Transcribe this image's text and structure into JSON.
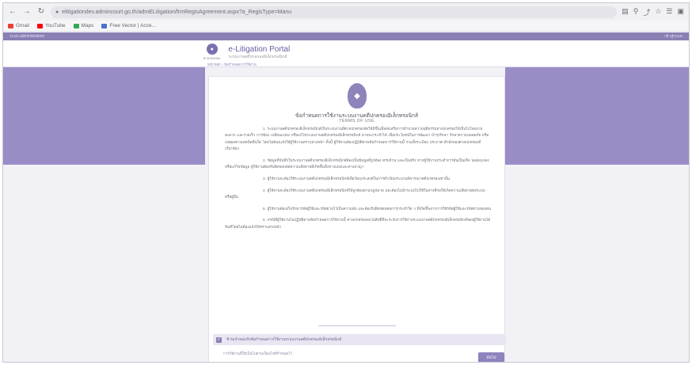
{
  "browser": {
    "url": "elitigationdev.admincourt.go.th/admELitigation/frmRegisAgreement.aspx?a_RegisType=Manu",
    "toolbar_icons": [
      "translate-icon",
      "zoom-icon",
      "share-icon",
      "star-icon",
      "reading-list-icon",
      "sidebar-icon"
    ],
    "bookmarks": [
      {
        "label": "Gmail",
        "color": "#ea4335"
      },
      {
        "label": "YouTube",
        "color": "#ff0000"
      },
      {
        "label": "Maps",
        "color": "#34a853"
      },
      {
        "label": "Free Vector | Acce...",
        "color": "#4a74c9"
      }
    ]
  },
  "app": {
    "strip_left": "ระบบ administration",
    "strip_right": "เข้าสู่ระบบ",
    "logo_caption": "ศาลปกครอง",
    "title": "e-Litigation Portal",
    "subtitle": "ระบบงานคดีปกครองอิเล็กทรอนิกส์",
    "breadcrumb": "หน้าหลัก › ข้อกำหนดการใช้งาน"
  },
  "terms": {
    "heading": "ข้อกำหนดการใช้งานระบบงานคดีปกครองอิเล็กทรอนิกส์",
    "subheading": "TERMS OF USE",
    "paragraphs": [
      "1. ระบบงานคดีปกครองอิเล็กทรอนิกส์เป็นระบบงานที่ศาลปกครองจัดให้มีขึ้นเพื่อส่งเสริมการอำนวยความยุติธรรมทางปกครองให้เป็นไปโดยง่าย สะดวก และรวดเร็ว การฟ้อง เปลี่ยนแปลง หรือแก้ไขระบบงานคดีปกครองอิเล็กทรอนิกส์ อาจจะกระทำได้ เพื่อประโยชน์ในการพัฒนา บำรุงรักษา รักษาความปลอดภัย หรือเหตุผลทางเทคนิคอื่นใด โดยไม่ต้องแจ้งให้ผู้ใช้งานทราบล่วงหน้า ทั้งนี้ ผู้ใช้งานต้องปฏิบัติตามข้อกำหนดการใช้งานนี้ รวมทั้งระเบียบ ประกาศ คำสั่งของศาลปกครองที่เกี่ยวข้อง",
      "2. ข้อมูลที่บันทึกในระบบงานคดีปกครองอิเล็กทรอนิกส์ต้องเป็นข้อมูลที่ถูกต้อง ครบถ้วน และเป็นจริง หากผู้ใช้งานกระทำการอันเป็นเท็จ ปลอมแปลง หรือแก้ไขข้อมูล ผู้ใช้งานต้องรับผิดชอบต่อความเสียหายที่เกิดขึ้นทั้งทางแพ่งและทางอาญา",
      "3. ผู้ใช้งานจะต้องใช้ระบบงานคดีปกครองอิเล็กทรอนิกส์เพื่อวัตถุประสงค์ในการดำเนินกระบวนพิจารณาคดีปกครองเท่านั้น",
      "4. ผู้ใช้งานจะต้องใช้ระบบงานคดีปกครองอิเล็กทรอนิกส์ให้ถูกต้องตามกฎหมาย และต้องไม่นำระบบไปใช้ในทางที่ก่อให้เกิดความเสียหายต่อระบบหรือผู้อื่น",
      "5. ผู้ใช้งานต้องเก็บรักษารหัสผู้ใช้และรหัสผ่านไว้เป็นความลับ และต้องรับผิดชอบต่อการกระทำใด ๆ ที่เกิดขึ้นจากการใช้รหัสผู้ใช้และรหัสผ่านของตน",
      "6. กรณีที่ผู้ใช้งานไม่ปฏิบัติตามข้อกำหนดการใช้งานนี้ ศาลปกครองสงวนสิทธิ์ที่จะระงับการใช้งานระบบงานคดีปกครองอิเล็กทรอนิกส์ของผู้ใช้งานได้ทันทีโดยไม่ต้องแจ้งให้ทราบล่วงหน้า"
    ],
    "agree_label": "ข้าพเจ้ายอมรับข้อกำหนดการใช้งานระบบงานคดีปกครองอิเล็กทรอนิกส์",
    "note": "การใช้งานนี้ให้เป็นไปตามเงื่อนไขที่กำหนดไว้",
    "next_label": "ถัดไป"
  },
  "colors": {
    "accent": "#8b7fb4",
    "band": "#9a8dc6"
  }
}
